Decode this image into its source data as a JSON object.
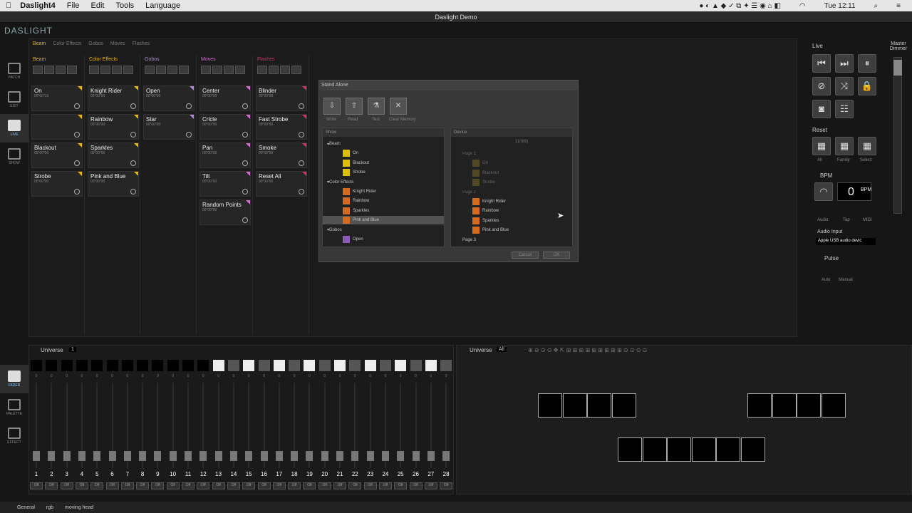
{
  "menubar": {
    "app": "Daslight4",
    "items": [
      "File",
      "Edit",
      "Tools",
      "Language"
    ],
    "clock": "Tue 12:11"
  },
  "window": {
    "title": "Daslight Demo",
    "logo": "DASLIGHT"
  },
  "nav": [
    {
      "label": "PATCH"
    },
    {
      "label": "EDIT"
    },
    {
      "label": "LIVE"
    },
    {
      "label": "SHOW"
    }
  ],
  "tabs": [
    "Beam",
    "Color Effects",
    "Gobos",
    "Moves",
    "Flashes"
  ],
  "columns": [
    {
      "name": "Beam",
      "color": "#e8b500",
      "cues": [
        {
          "name": "On",
          "time": "00\"00\"16"
        },
        {
          "name": "",
          "time": ""
        },
        {
          "name": "Blackout",
          "time": "00\"00\"00"
        },
        {
          "name": "Strobe",
          "time": "00\"00\"00"
        }
      ]
    },
    {
      "name": "Color Effects",
      "color": "#e8b500",
      "cues": [
        {
          "name": "Knight Rider",
          "time": "00\"00\"00"
        },
        {
          "name": "Rainbow",
          "time": "00\"00\"00"
        },
        {
          "name": "Sparkles",
          "time": "00\"00\"00"
        },
        {
          "name": "Pink and Blue",
          "time": "00\"00\"00"
        }
      ]
    },
    {
      "name": "Gobos",
      "color": "#b08ad8",
      "cues": [
        {
          "name": "Open",
          "time": "00\"00\"00"
        },
        {
          "name": "Star",
          "time": "00\"00\"00"
        }
      ]
    },
    {
      "name": "Moves",
      "color": "#d070d0",
      "cues": [
        {
          "name": "Center",
          "time": "00\"00\"00"
        },
        {
          "name": "Crlcle",
          "time": "00\"00\"00"
        },
        {
          "name": "Pan",
          "time": "00\"00\"00"
        },
        {
          "name": "Tilt",
          "time": "00\"00\"00"
        },
        {
          "name": "Random Points",
          "time": "00\"00\"00"
        }
      ]
    },
    {
      "name": "Flashes",
      "color": "#d0306a",
      "cues": [
        {
          "name": "Blinder",
          "time": "00\"00\"00"
        },
        {
          "name": "Fast Strobe",
          "time": "00\"00\"00"
        },
        {
          "name": "Smoke",
          "time": "00\"00\"00"
        },
        {
          "name": "Reset All",
          "time": "00\"00\"00"
        }
      ]
    }
  ],
  "dialog": {
    "title": "Stand Alone",
    "buttons": [
      "Write",
      "Read",
      "Test",
      "Clear Memory"
    ],
    "show_header": "Show",
    "device_header": "Device",
    "show_tree": [
      {
        "label": "Beam",
        "group": true
      },
      {
        "label": "On",
        "color": "#e8c800"
      },
      {
        "label": "Blackout",
        "color": "#e8c800"
      },
      {
        "label": "Strobe",
        "color": "#e8c800"
      },
      {
        "label": "Color Effects",
        "group": true
      },
      {
        "label": "Knight Rider",
        "color": "#e07020"
      },
      {
        "label": "Rainbow",
        "color": "#e07020"
      },
      {
        "label": "Sparkles",
        "color": "#e07020"
      },
      {
        "label": "Pink and Blue",
        "color": "#e07020"
      },
      {
        "label": "Gobos",
        "group": true
      },
      {
        "label": "Open",
        "color": "#9060c0"
      }
    ],
    "device_tree": [
      {
        "label": "Page 1"
      },
      {
        "label": "On"
      },
      {
        "label": "Blackout"
      },
      {
        "label": "Strobe"
      },
      {
        "label": "Page 2"
      },
      {
        "label": "Knight Rider"
      },
      {
        "label": "Rainbow"
      },
      {
        "label": "Sparkles"
      },
      {
        "label": "Pink and Blue"
      },
      {
        "label": "Page 3"
      }
    ],
    "device_id": "11089)",
    "cancel": "Cancel",
    "ok": "OK"
  },
  "right": {
    "live": "Live",
    "reset": "Reset",
    "pads": [
      "All",
      "Family",
      "Select"
    ],
    "bpm_label": "BPM",
    "bpm_value": "0",
    "bpm_unit": "BPM",
    "bpm_modes": [
      "Audio",
      "Tap",
      "MIDI"
    ],
    "audio_input_label": "Audio Input",
    "audio_input_value": "Apple USB audio devic",
    "pulse": "Pulse",
    "pulse_modes": [
      "Auto",
      "Manual"
    ],
    "master_dimmer": "Master\nDimmer"
  },
  "universe_left": {
    "label": "Universe",
    "value": "1",
    "nav": [
      "FADER",
      "PALETTE",
      "EFFECT"
    ]
  },
  "universe_right": {
    "label": "Universe",
    "value": "All"
  },
  "faders": [
    "1",
    "2",
    "3",
    "4",
    "5",
    "6",
    "7",
    "8",
    "9",
    "10",
    "11",
    "12",
    "13",
    "14",
    "15",
    "16",
    "17",
    "18",
    "19",
    "20",
    "21",
    "22",
    "23",
    "24",
    "25",
    "26",
    "27",
    "28"
  ],
  "fader_off": "Off",
  "status": [
    "General",
    "rgb",
    "moving head"
  ]
}
